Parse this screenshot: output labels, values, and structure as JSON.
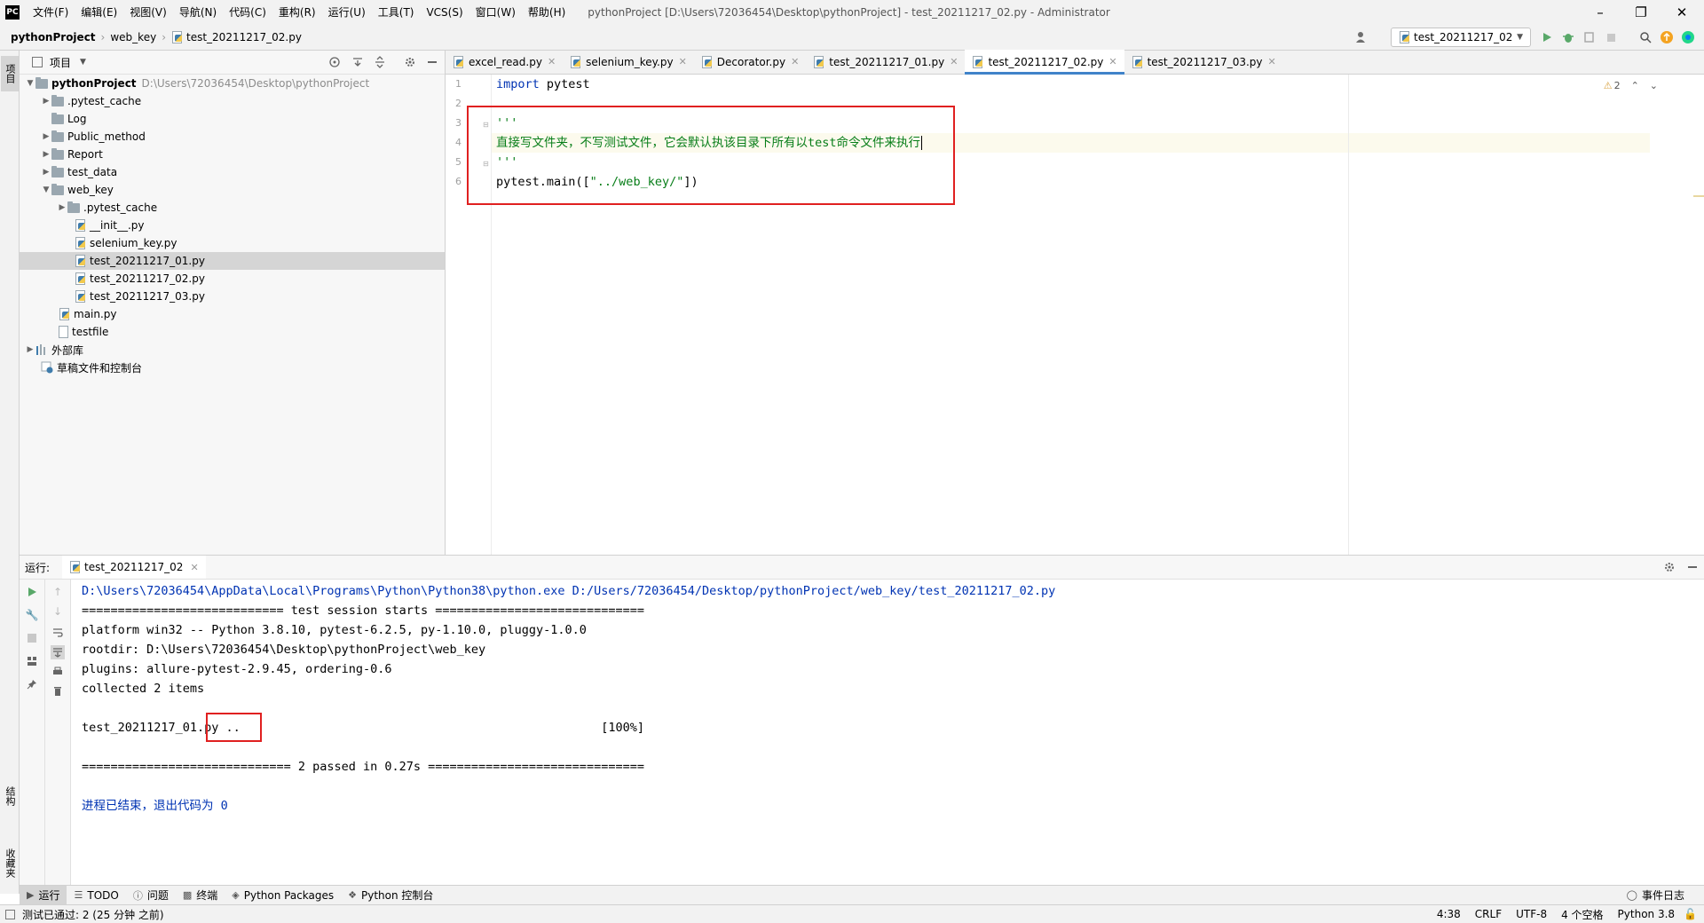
{
  "menubar": {
    "logo": "PC",
    "items": [
      "文件(F)",
      "编辑(E)",
      "视图(V)",
      "导航(N)",
      "代码(C)",
      "重构(R)",
      "运行(U)",
      "工具(T)",
      "VCS(S)",
      "窗口(W)",
      "帮助(H)"
    ],
    "title": "pythonProject [D:\\Users\\72036454\\Desktop\\pythonProject] - test_20211217_02.py - Administrator"
  },
  "navbar": {
    "crumbs": [
      "pythonProject",
      "web_key",
      "test_20211217_02.py"
    ],
    "run_config": "test_20211217_02"
  },
  "left_strip": {
    "project": "项目",
    "structure": "结构",
    "favorites": "收藏夹"
  },
  "project_panel": {
    "title": "项目",
    "tree": [
      {
        "label": "pythonProject",
        "hint": "D:\\Users\\72036454\\Desktop\\pythonProject"
      },
      {
        "label": ".pytest_cache"
      },
      {
        "label": "Log"
      },
      {
        "label": "Public_method"
      },
      {
        "label": "Report"
      },
      {
        "label": "test_data"
      },
      {
        "label": "web_key"
      },
      {
        "label": ".pytest_cache"
      },
      {
        "label": "__init__.py"
      },
      {
        "label": "selenium_key.py"
      },
      {
        "label": "test_20211217_01.py"
      },
      {
        "label": "test_20211217_02.py"
      },
      {
        "label": "test_20211217_03.py"
      },
      {
        "label": "main.py"
      },
      {
        "label": "testfile"
      },
      {
        "label": "外部库"
      },
      {
        "label": "草稿文件和控制台"
      }
    ]
  },
  "editor": {
    "tabs": [
      "excel_read.py",
      "selenium_key.py",
      "Decorator.py",
      "test_20211217_01.py",
      "test_20211217_02.py",
      "test_20211217_03.py"
    ],
    "active_tab": "test_20211217_02.py",
    "line_numbers": [
      "1",
      "2",
      "3",
      "4",
      "5",
      "6"
    ],
    "code": {
      "l1_kw": "import",
      "l1_rest": " pytest",
      "l3": "'''",
      "l4": "直接写文件夹，不写测试文件，它会默认执该目录下所有以test命令文件来执行",
      "l5": "'''",
      "l6_a": "pytest.main([",
      "l6_str": "\"../web_key/\"",
      "l6_b": "])"
    },
    "inspection_count": "2"
  },
  "run_panel": {
    "label": "运行:",
    "tab": "test_20211217_02",
    "console": [
      "D:\\Users\\72036454\\AppData\\Local\\Programs\\Python\\Python38\\python.exe D:/Users/72036454/Desktop/pythonProject/web_key/test_20211217_02.py",
      "============================ test session starts =============================",
      "platform win32 -- Python 3.8.10, pytest-6.2.5, py-1.10.0, pluggy-1.0.0",
      "rootdir: D:\\Users\\72036454\\Desktop\\pythonProject\\web_key",
      "plugins: allure-pytest-2.9.45, ordering-0.6",
      "collected 2 items",
      "",
      "test_20211217_01.py ..                                                  [100%]",
      "",
      "============================= 2 passed in 0.27s ==============================",
      "",
      "进程已结束，退出代码为 0"
    ]
  },
  "bottom_bar": {
    "items": [
      "运行",
      "TODO",
      "问题",
      "终端",
      "Python Packages",
      "Python 控制台"
    ],
    "event_log": "事件日志"
  },
  "status_bar": {
    "message": "测试已通过: 2 (25 分钟 之前)",
    "position": "4:38",
    "line_sep": "CRLF",
    "encoding": "UTF-8",
    "indent": "4 个空格",
    "interpreter": "Python 3.8"
  }
}
